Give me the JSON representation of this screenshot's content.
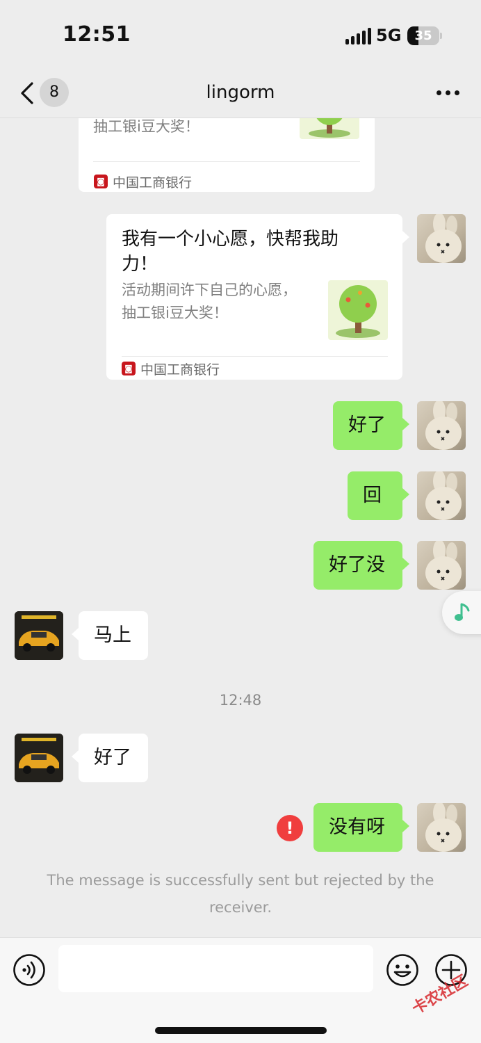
{
  "status_bar": {
    "time": "12:51",
    "network": "5G",
    "battery": "35",
    "battery_level": 0.35
  },
  "nav": {
    "unread_count": "8",
    "title": "lingorm"
  },
  "cards": [
    {
      "desc_line2": "抽工银i豆大奖！",
      "source": "中国工商银行"
    },
    {
      "title_line1": "我有一个小心愿，快帮我助",
      "title_line2": "力！",
      "desc_line1": "活动期间许下自己的心愿，",
      "desc_line2": "抽工银i豆大奖！",
      "source": "中国工商银行"
    }
  ],
  "messages": [
    {
      "text": "好了",
      "direction": "out"
    },
    {
      "text": "回",
      "direction": "out"
    },
    {
      "text": "好了没",
      "direction": "out"
    },
    {
      "text": "马上",
      "direction": "in"
    },
    {
      "text": "好了",
      "direction": "in"
    },
    {
      "text": "没有呀",
      "direction": "out",
      "error": true
    }
  ],
  "timestamp": "12:48",
  "error_mark": "!",
  "system_notice": "The message is successfully sent but rejected by the receiver.",
  "watermark": "卡农社区",
  "colors": {
    "outgoing_bubble": "#95ec69",
    "incoming_bubble": "#ffffff",
    "background": "#ededed",
    "error": "#f03e3e",
    "bank": "#c8161d"
  },
  "icons": [
    "back-chevron-icon",
    "more-icon",
    "bank-logo-icon",
    "music-note-icon",
    "voice-icon",
    "emoji-icon",
    "plus-icon",
    "error-icon"
  ]
}
